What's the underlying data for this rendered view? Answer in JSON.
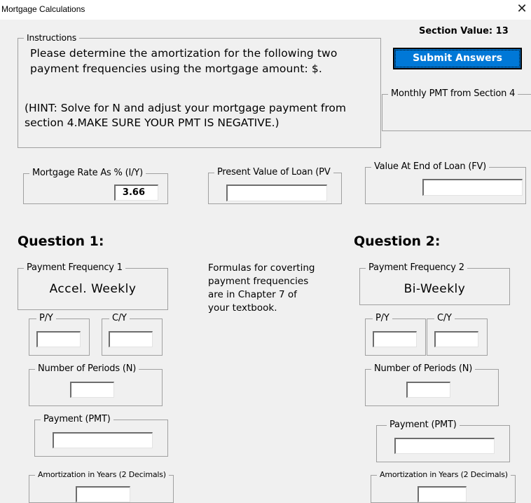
{
  "window": {
    "title": "Mortgage Calculations",
    "close_icon": "close-icon"
  },
  "header": {
    "section_value": "Section Value: 13",
    "submit_label": "Submit Answers",
    "accent_color": "#0078d7"
  },
  "instructions": {
    "legend": "Instructions",
    "line1": "Please determine the amortization for the following two",
    "line2": "payment frequencies using the mortgage amount: $.",
    "hint_line1": "(HINT: Solve for N and adjust your mortgage payment from",
    "hint_line2": "section 4.MAKE SURE YOUR PMT IS NEGATIVE.)"
  },
  "monthly_pmt": {
    "legend": "Monthly PMT from Section 4",
    "value": ""
  },
  "inputs": {
    "rate": {
      "legend": "Mortgage Rate As % (I/Y)",
      "value": "3.66"
    },
    "pv": {
      "legend": "Present Value of Loan (PV",
      "value": ""
    },
    "fv": {
      "legend": "Value At End of Loan (FV)",
      "value": ""
    }
  },
  "formula_note": {
    "lines": [
      "Formulas for coverting",
      "payment frequencies",
      "are in Chapter 7 of",
      "your textbook."
    ]
  },
  "questions": [
    {
      "title": "Question 1:",
      "freq_legend": "Payment Frequency 1",
      "freq_value": "Accel. Weekly",
      "py_legend": "P/Y",
      "py_value": "",
      "cy_legend": "C/Y",
      "cy_value": "",
      "n_legend": "Number of Periods (N)",
      "n_value": "",
      "pmt_legend": "Payment (PMT)",
      "pmt_value": "",
      "amort_legend": "Amortization in Years (2 Decimals)",
      "amort_value": ""
    },
    {
      "title": "Question 2:",
      "freq_legend": "Payment Frequency 2",
      "freq_value": "Bi-Weekly",
      "py_legend": "P/Y",
      "py_value": "",
      "cy_legend": "C/Y",
      "cy_value": "",
      "n_legend": "Number of Periods (N)",
      "n_value": "",
      "pmt_legend": "Payment (PMT)",
      "pmt_value": "",
      "amort_legend": "Amortization in Years (2 Decimals)",
      "amort_value": ""
    }
  ]
}
